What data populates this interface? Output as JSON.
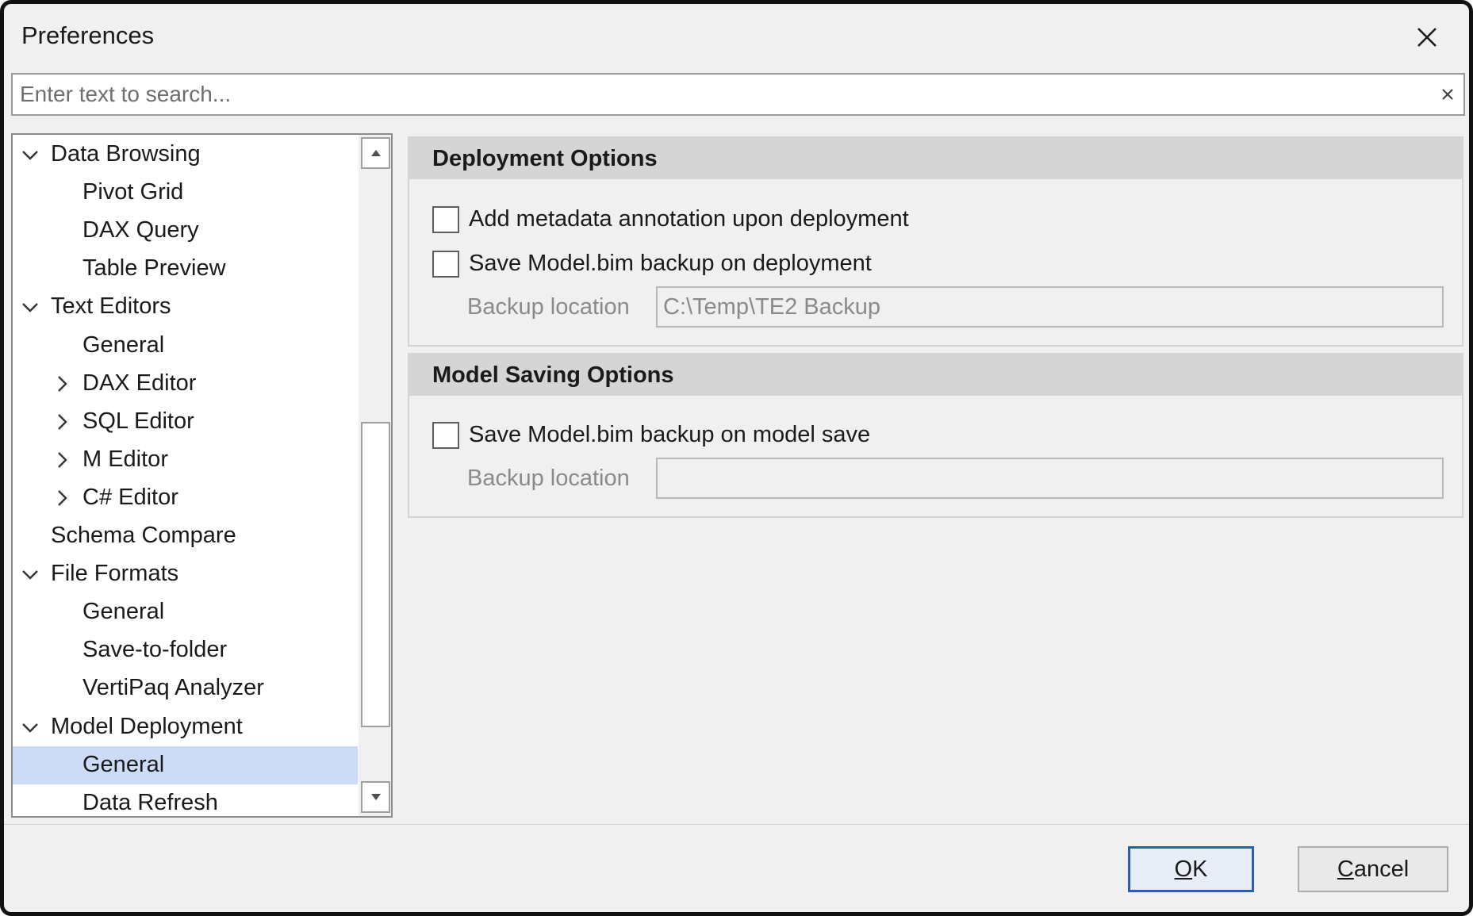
{
  "window": {
    "title": "Preferences"
  },
  "search": {
    "placeholder": "Enter text to search...",
    "value": ""
  },
  "tree": {
    "items": [
      {
        "label": "Data Browsing",
        "level": 0,
        "expander": "chevron-down"
      },
      {
        "label": "Pivot Grid",
        "level": 1,
        "expander": ""
      },
      {
        "label": "DAX Query",
        "level": 1,
        "expander": ""
      },
      {
        "label": "Table Preview",
        "level": 1,
        "expander": ""
      },
      {
        "label": "Text Editors",
        "level": 0,
        "expander": "chevron-down"
      },
      {
        "label": "General",
        "level": 1,
        "expander": ""
      },
      {
        "label": "DAX Editor",
        "level": 1,
        "expander": "chevron-right"
      },
      {
        "label": "SQL Editor",
        "level": 1,
        "expander": "chevron-right"
      },
      {
        "label": "M Editor",
        "level": 1,
        "expander": "chevron-right"
      },
      {
        "label": "C# Editor",
        "level": 1,
        "expander": "chevron-right"
      },
      {
        "label": "Schema Compare",
        "level": 0,
        "expander": ""
      },
      {
        "label": "File Formats",
        "level": 0,
        "expander": "chevron-down"
      },
      {
        "label": "General",
        "level": 1,
        "expander": ""
      },
      {
        "label": "Save-to-folder",
        "level": 1,
        "expander": ""
      },
      {
        "label": "VertiPaq Analyzer",
        "level": 1,
        "expander": ""
      },
      {
        "label": "Model Deployment",
        "level": 0,
        "expander": "chevron-down"
      },
      {
        "label": "General",
        "level": 1,
        "expander": "",
        "selected": true
      },
      {
        "label": "Data Refresh",
        "level": 1,
        "expander": ""
      }
    ]
  },
  "deployment": {
    "header": "Deployment Options",
    "add_metadata": {
      "label": "Add metadata annotation upon deployment",
      "checked": false
    },
    "save_backup": {
      "label": "Save Model.bim backup on deployment",
      "checked": false
    },
    "backup_location_label": "Backup location",
    "backup_location_value": "C:\\Temp\\TE2 Backup"
  },
  "model_saving": {
    "header": "Model Saving Options",
    "save_backup": {
      "label": "Save Model.bim backup on model save",
      "checked": false
    },
    "backup_location_label": "Backup location",
    "backup_location_value": ""
  },
  "buttons": {
    "ok_underline": "O",
    "ok_rest": "K",
    "cancel_underline": "C",
    "cancel_rest": "ancel"
  },
  "colors": {
    "selection": "#cddcf6",
    "group_header": "#d5d5d5",
    "default_button_border": "#2f5ea8"
  }
}
